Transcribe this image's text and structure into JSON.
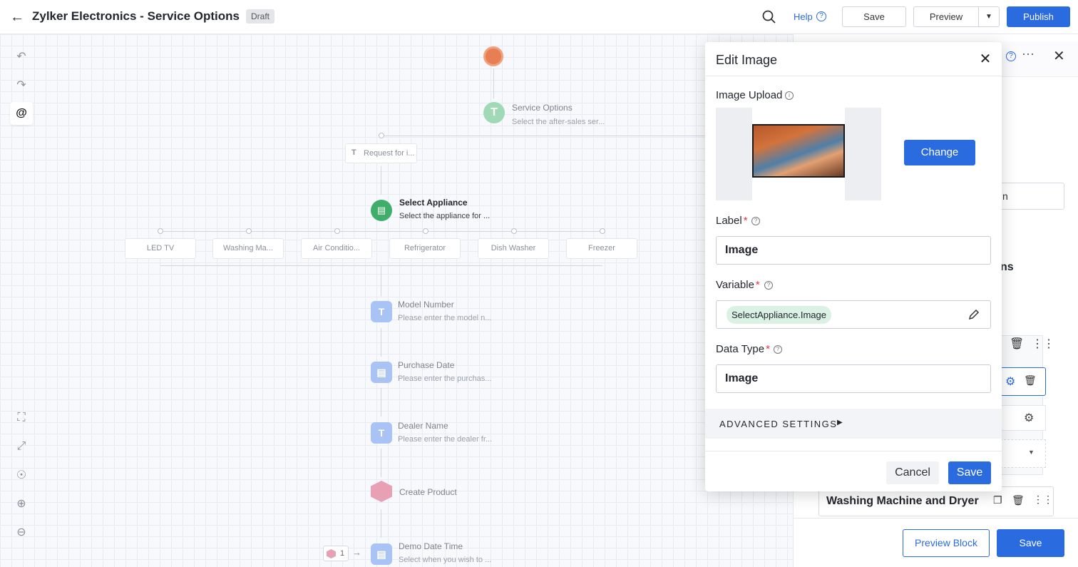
{
  "header": {
    "title": "Zylker Electronics - Service Options",
    "badge": "Draft",
    "help_label": "Help",
    "save_label": "Save",
    "preview_label": "Preview",
    "publish_label": "Publish"
  },
  "flow": {
    "start": {
      "title": "Service Options",
      "subtitle": "Select the after-sales ser..."
    },
    "request_node": "Request for i...",
    "select_appliance": {
      "title": "Select Appliance",
      "subtitle": "Select the appliance for ..."
    },
    "choices": [
      "LED TV",
      "Washing Ma...",
      "Air Conditio...",
      "Refrigerator",
      "Dish Washer",
      "Freezer"
    ],
    "steps": [
      {
        "title": "Model Number",
        "subtitle": "Please enter the model n..."
      },
      {
        "title": "Purchase Date",
        "subtitle": "Please enter the purchas..."
      },
      {
        "title": "Dealer Name",
        "subtitle": "Please enter the dealer fr..."
      },
      {
        "title": "Create Product",
        "subtitle": ""
      },
      {
        "title": "Demo Date Time",
        "subtitle": "Select when you wish to ..."
      }
    ],
    "demo_badge_count": "1"
  },
  "right_panel": {
    "partial_input": "n",
    "partial_heading": "ns",
    "option_row": "Washing Machine and Dryer",
    "preview_block_label": "Preview Block",
    "save_label": "Save"
  },
  "modal": {
    "title": "Edit Image",
    "image_upload_label": "Image Upload",
    "change_label": "Change",
    "label_label": "Label",
    "label_value": "Image",
    "variable_label": "Variable",
    "variable_value": "SelectAppliance.Image",
    "data_type_label": "Data Type",
    "data_type_value": "Image",
    "advanced_label": "ADVANCED SETTINGS",
    "cancel_label": "Cancel",
    "save_label": "Save"
  },
  "colors": {
    "primary": "#2a6be0",
    "required": "#e0334a",
    "chip": "#dbf1e4",
    "node_green": "#3fae6a",
    "node_pink": "#e8a0b4"
  }
}
